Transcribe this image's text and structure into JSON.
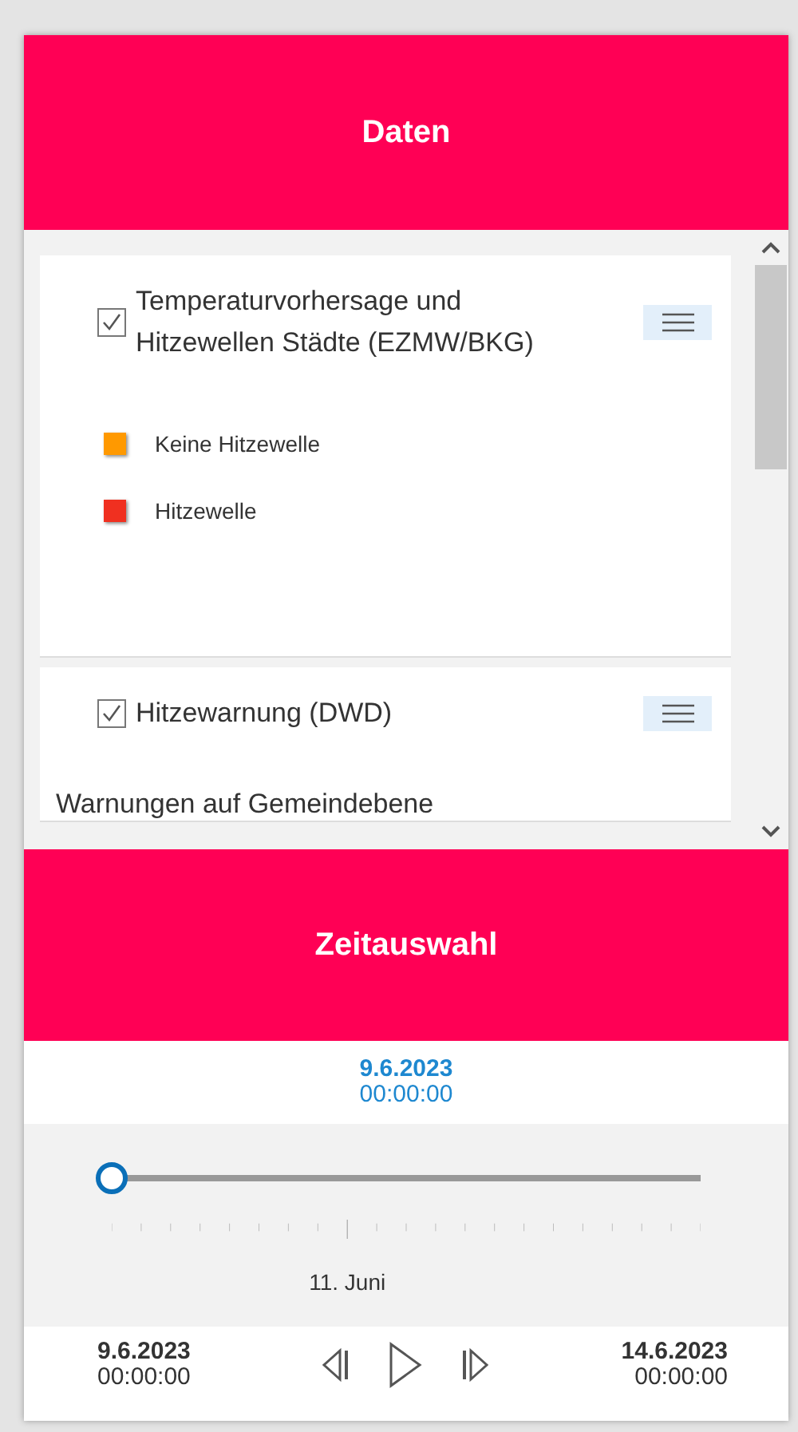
{
  "data_panel": {
    "title": "Daten",
    "layers": [
      {
        "title": "Temperaturvorhersage und Hitzewellen Städte (EZMW/BKG)",
        "checked": true,
        "legend": [
          {
            "label": "Keine Hitzewelle",
            "color": "#ff9900"
          },
          {
            "label": "Hitzewelle",
            "color": "#f03020"
          }
        ]
      },
      {
        "title": "Hitzewarnung (DWD)",
        "checked": true,
        "description": "Warnungen auf Gemeindebene"
      }
    ]
  },
  "time_panel": {
    "title": "Zeitauswahl",
    "current_date": "9.6.2023",
    "current_time": "00:00:00",
    "slider": {
      "level": 0,
      "tick_label": "11. Juni"
    },
    "start_date": "9.6.2023",
    "start_time": "00:00:00",
    "end_date": "14.6.2023",
    "end_time": "00:00:00"
  }
}
